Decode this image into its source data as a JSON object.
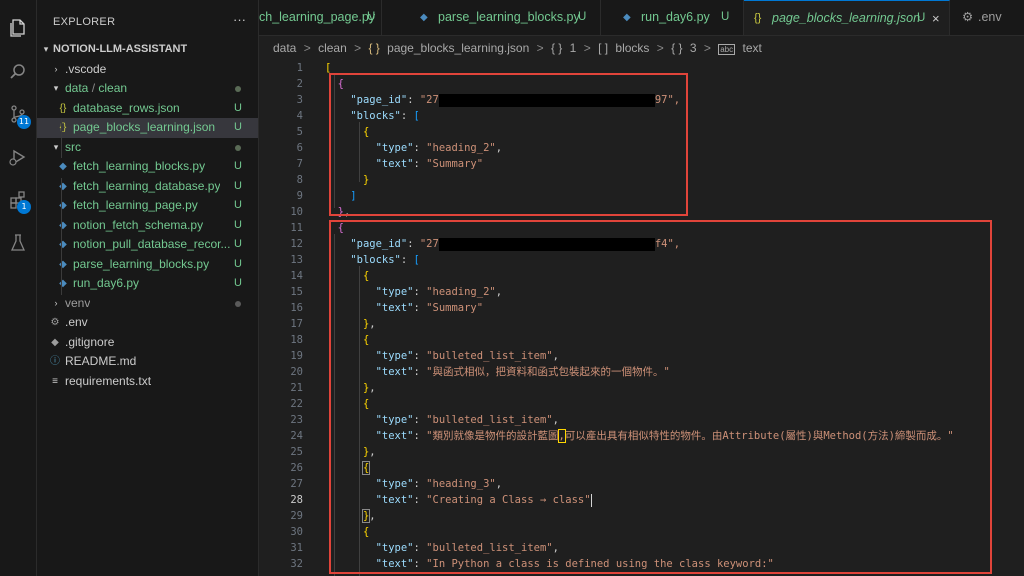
{
  "sidebar": {
    "title": "EXPLORER",
    "more": "···",
    "root": "NOTION-LLM-ASSISTANT",
    "items": [
      {
        "label": "vscode_dir",
        "text": ".vscode",
        "badge": ""
      },
      {
        "label": "data_clean",
        "text": "data",
        "text2": "clean",
        "badge": ""
      },
      {
        "label": "database_rows",
        "text": "database_rows.json",
        "badge": "U"
      },
      {
        "label": "page_blocks_learning",
        "text": "page_blocks_learning.json",
        "badge": "U"
      },
      {
        "label": "src",
        "text": "src",
        "badge": ""
      },
      {
        "label": "fetch_learning_blocks",
        "text": "fetch_learning_blocks.py",
        "badge": "U"
      },
      {
        "label": "fetch_learning_database",
        "text": "fetch_learning_database.py",
        "badge": "U"
      },
      {
        "label": "fetch_learning_page",
        "text": "fetch_learning_page.py",
        "badge": "U"
      },
      {
        "label": "notion_fetch_schema",
        "text": "notion_fetch_schema.py",
        "badge": "U"
      },
      {
        "label": "notion_pull_database",
        "text": "notion_pull_database_recor...",
        "badge": "U"
      },
      {
        "label": "parse_learning_blocks",
        "text": "parse_learning_blocks.py",
        "badge": "U"
      },
      {
        "label": "run_day6",
        "text": "run_day6.py",
        "badge": "U"
      },
      {
        "label": "venv",
        "text": "venv",
        "badge": ""
      },
      {
        "label": "env",
        "text": ".env",
        "badge": ""
      },
      {
        "label": "gitignore",
        "text": ".gitignore",
        "badge": ""
      },
      {
        "label": "readme",
        "text": "README.md",
        "badge": ""
      },
      {
        "label": "requirements",
        "text": "requirements.txt",
        "badge": ""
      }
    ]
  },
  "activity": {
    "scm_badge": "11",
    "ext_badge": "1"
  },
  "tabs": [
    {
      "name": "ch_learning_page.py",
      "badge": "U"
    },
    {
      "name": "parse_learning_blocks.py",
      "badge": "U"
    },
    {
      "name": "run_day6.py",
      "badge": "U"
    },
    {
      "name": "page_blocks_learning.json",
      "badge": "U",
      "close": "×"
    },
    {
      "name": ".env",
      "badge": ""
    }
  ],
  "breadcrumb": {
    "p1": "data",
    "p2": "clean",
    "p3": "page_blocks_learning.json",
    "p4": "1",
    "p5": "blocks",
    "p6": "3",
    "p7": "text",
    "sep": ">",
    "obj": "{ }",
    "arr": "[ ]",
    "strico": "abc"
  },
  "editor": {
    "current_line": 28,
    "line_numbers": [
      "1",
      "2",
      "3",
      "4",
      "5",
      "6",
      "7",
      "8",
      "9",
      "10",
      "11",
      "12",
      "13",
      "14",
      "15",
      "16",
      "17",
      "18",
      "19",
      "20",
      "21",
      "22",
      "23",
      "24",
      "25",
      "26",
      "27",
      "28",
      "29",
      "30",
      "31",
      "32"
    ],
    "page1_id_prefix": "\"27",
    "page1_id_suffix": "97\",",
    "page2_id_prefix": "\"27",
    "page2_id_suffix": "f4\",",
    "strings": {
      "page_id_key": "\"page_id\"",
      "blocks_key": "\"blocks\"",
      "type_key": "\"type\"",
      "text_key": "\"text\"",
      "heading_2": "\"heading_2\"",
      "heading_3": "\"heading_3\"",
      "bulleted": "\"bulleted_list_item\"",
      "summary": "\"Summary\"",
      "t20": "\"與函式相似，把資料和函式包裝起來的一個物件。\"",
      "t24a": "\"類別就像是物件的設計藍圖",
      "t24b": "可以產出具有相似特性的物件。由Attribute(屬性)與Method(方法)締製而成。\"",
      "t28": "\"Creating a Class → class\"",
      "t32": "\"In Python a class is defined using the class keyword:\""
    }
  }
}
